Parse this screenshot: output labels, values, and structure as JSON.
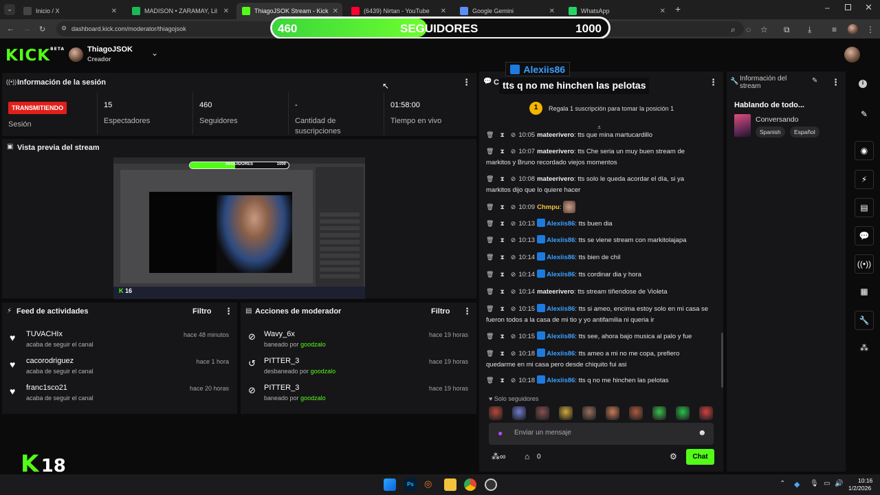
{
  "browser": {
    "tabs": [
      {
        "label": "Inicio / X",
        "color": "#444"
      },
      {
        "label": "MADISON • ZARAMAY, Lil",
        "color": "#1db954"
      },
      {
        "label": "ThiagoJSOK Stream - Kick Dash",
        "color": "#53fc18"
      },
      {
        "label": "(6439) Nirtan - YouTube",
        "color": "#ff0033"
      },
      {
        "label": "Google Gemini",
        "color": "#5b8ef7"
      },
      {
        "label": "WhatsApp",
        "color": "#25d366"
      }
    ],
    "new_tab": "+",
    "url": "dashboard.kick.com/moderator/thiagojsok"
  },
  "overlay": {
    "followers_current": "460",
    "followers_label": "SEGUIDORES",
    "followers_goal": "1000",
    "progress": 0.46
  },
  "header": {
    "logo": "KICK",
    "logo_badge": "BETA",
    "username": "ThiagoJSOK",
    "role": "Creador"
  },
  "session": {
    "title": "Información de la sesión",
    "status_badge": "TRANSMITIENDO",
    "status_label": "Sesión",
    "stats": [
      {
        "value": "15",
        "label": "Espectadores"
      },
      {
        "value": "460",
        "label": "Seguidores"
      },
      {
        "value": "-",
        "label": "Cantidad de suscripciones"
      },
      {
        "value": "01:58:00",
        "label": "Tiempo en vivo"
      }
    ]
  },
  "preview": {
    "title": "Vista previa del stream",
    "mini_label": "SEGUIDORES",
    "mini_goal": "1000",
    "corner_badge": "16"
  },
  "activity": {
    "title": "Feed de actividades",
    "filter": "Filtro",
    "items": [
      {
        "name": "TUVACHIx",
        "action": "acaba de seguir el canal",
        "time": "hace 48 minutos"
      },
      {
        "name": "cacorodriguez",
        "action": "acaba de seguir el canal",
        "time": "hace 1 hora"
      },
      {
        "name": "franc1sco21",
        "action": "acaba de seguir el canal",
        "time": "hace 20 horas"
      }
    ]
  },
  "modactions": {
    "title": "Acciones de moderador",
    "filter": "Filtro",
    "items": [
      {
        "name": "Wavy_6x",
        "action": "baneado por",
        "by": "goodzalo",
        "time": "hace 19 horas"
      },
      {
        "name": "PITTER_3",
        "action": "desbaneado por",
        "by": "goodzalo",
        "time": "hace 19 horas"
      },
      {
        "name": "PITTER_3",
        "action": "baneado por",
        "by": "goodzalo",
        "time": "hace 19 horas"
      }
    ]
  },
  "chat": {
    "title": "Chat",
    "tts_user": "Alexiis86",
    "tts_message": "tts q no me hinchen las pelotas",
    "gift_rank": "1",
    "gift_text": "Regala 1 suscripción para tomar la posición 1",
    "messages": [
      {
        "time": "10:05",
        "user": "mateerivero",
        "text": "tts que mina martucardillo",
        "blue": false
      },
      {
        "time": "10:07",
        "user": "mateerivero",
        "text": "tts Che seria un muy buen stream de markitos y Bruno recordado viejos momentos",
        "blue": false
      },
      {
        "time": "10:08",
        "user": "mateerivero",
        "text": "tts solo le queda acordar el día, si ya markitos dijo que lo quiere hacer",
        "blue": false
      },
      {
        "time": "10:09",
        "user": "Chmpu",
        "text": "",
        "blue": false
      },
      {
        "time": "10:13",
        "user": "Alexiis86",
        "text": "tts buen dia",
        "blue": true
      },
      {
        "time": "10:13",
        "user": "Alexiis86",
        "text": "tts se viene stream con markitolajapa",
        "blue": true
      },
      {
        "time": "10:14",
        "user": "Alexiis86",
        "text": "tts bien de chil",
        "blue": true
      },
      {
        "time": "10:14",
        "user": "Alexiis86",
        "text": "tts cordinar dia y hora",
        "blue": true
      },
      {
        "time": "10:14",
        "user": "mateerivero",
        "text": "tts stream tiñendose de Violeta",
        "blue": false
      },
      {
        "time": "10:15",
        "user": "Alexiis86",
        "text": "tts si ameo, encima estoy solo en mi casa se fueron todos a la casa de mi tio y yo antifamilia ni queria ir",
        "blue": true
      },
      {
        "time": "10:15",
        "user": "Alexiis86",
        "text": "tts see, ahora bajo musica al palo y fue",
        "blue": true
      },
      {
        "time": "10:18",
        "user": "Alexiis86",
        "text": "tts ameo a mi no me copa, prefiero quedarme en mi casa pero desde chiquito fui asi",
        "blue": true
      },
      {
        "time": "10:18",
        "user": "Alexiis86",
        "text": "tts q no me hinchen las pelotas",
        "blue": true
      }
    ],
    "followers_only": "Solo seguidores",
    "input_placeholder": "Enviar un mensaje",
    "points": "0",
    "send_button": "Chat"
  },
  "streaminfo": {
    "title": "Información del stream",
    "stream_title": "Hablando de todo...",
    "category": "Conversando",
    "tags": [
      "Spanish",
      "Español"
    ]
  },
  "corner_logo": {
    "letter": "K",
    "number": "18"
  },
  "taskbar": {
    "time": "10:16",
    "date": "1/2/2026"
  },
  "colors": {
    "accent": "#53fc18",
    "live": "#e0201b",
    "link_blue": "#3aa0ff"
  }
}
